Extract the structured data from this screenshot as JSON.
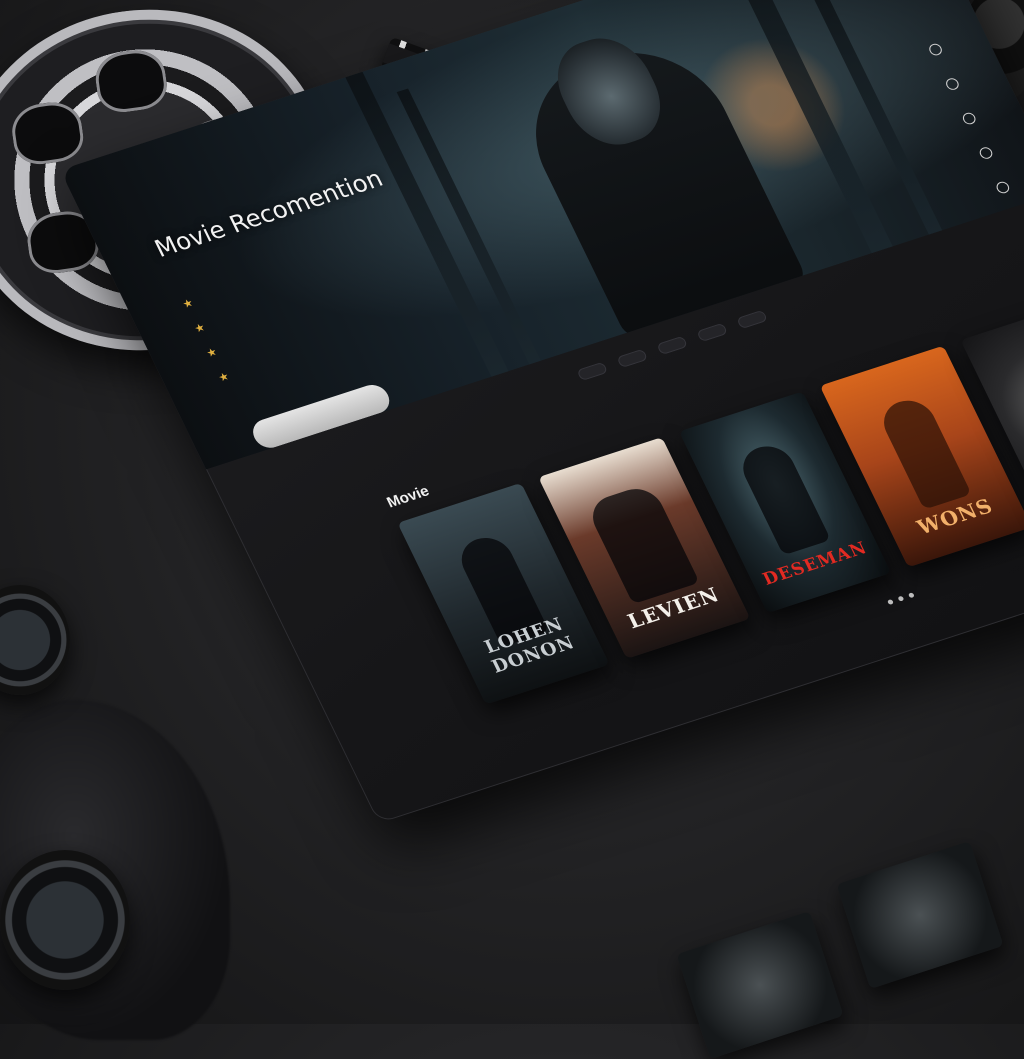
{
  "app": {
    "hero": {
      "title": "Movie Recomention",
      "subtitle": "",
      "features": [
        "",
        "",
        "",
        ""
      ],
      "cta_label": "",
      "side_labels": [
        "",
        "",
        "",
        "",
        ""
      ]
    },
    "top_nav": [
      "",
      "",
      "",
      ""
    ],
    "chips": [
      "",
      "",
      "",
      "",
      ""
    ],
    "section": {
      "title": "Movie"
    },
    "posters": [
      {
        "title": "LOHEN DONON"
      },
      {
        "title": "LEVIEN"
      },
      {
        "title": "DESEMAN"
      },
      {
        "title": "WONS"
      },
      {
        "title": ""
      }
    ]
  },
  "colors": {
    "background": "#242426",
    "panel": "#1a1a1c",
    "accent": "#e22a22",
    "highlight": "#d8661d"
  },
  "icons": [
    "star-icon",
    "circle-icon",
    "film-reel-icon"
  ]
}
